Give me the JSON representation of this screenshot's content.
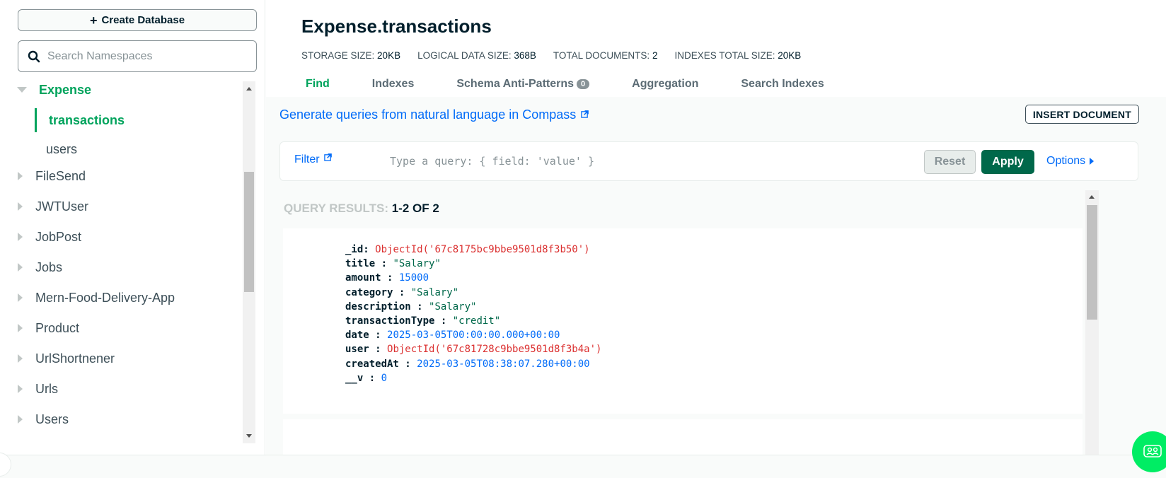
{
  "sidebar": {
    "create_database_label": "Create Database",
    "search_placeholder": "Search Namespaces",
    "databases": [
      {
        "name": "Expense",
        "expanded": true,
        "collections": [
          "transactions",
          "users"
        ],
        "active_collection": "transactions"
      },
      {
        "name": "FileSend"
      },
      {
        "name": "JWTUser"
      },
      {
        "name": "JobPost"
      },
      {
        "name": "Jobs"
      },
      {
        "name": "Mern-Food-Delivery-App"
      },
      {
        "name": "Product"
      },
      {
        "name": "UrlShortnener"
      },
      {
        "name": "Urls"
      },
      {
        "name": "Users"
      }
    ]
  },
  "header": {
    "title": "Expense.transactions",
    "stats": [
      {
        "label": "STORAGE SIZE:",
        "value": "20KB"
      },
      {
        "label": "LOGICAL DATA SIZE:",
        "value": "368B"
      },
      {
        "label": "TOTAL DOCUMENTS:",
        "value": "2"
      },
      {
        "label": "INDEXES TOTAL SIZE:",
        "value": "20KB"
      }
    ],
    "tabs": [
      {
        "label": "Find",
        "active": true
      },
      {
        "label": "Indexes"
      },
      {
        "label": "Schema Anti-Patterns",
        "badge": "0"
      },
      {
        "label": "Aggregation"
      },
      {
        "label": "Search Indexes"
      }
    ]
  },
  "toolbar": {
    "gen_queries_link": "Generate queries from natural language in Compass",
    "insert_document_label": "INSERT DOCUMENT"
  },
  "filter": {
    "label": "Filter",
    "placeholder": "Type a query: { field: 'value' }",
    "reset_label": "Reset",
    "apply_label": "Apply",
    "options_label": "Options"
  },
  "results": {
    "label": "QUERY RESULTS:",
    "count": "1-2 OF 2",
    "documents": [
      {
        "fields": [
          {
            "key": "_id",
            "value": "ObjectId('67c8175bc9bbe9501d8f3b50')",
            "type": "oid"
          },
          {
            "key": "title",
            "value": "\"Salary\"",
            "type": "str"
          },
          {
            "key": "amount",
            "value": "15000",
            "type": "num"
          },
          {
            "key": "category",
            "value": "\"Salary\"",
            "type": "str"
          },
          {
            "key": "description",
            "value": "\"Salary\"",
            "type": "str"
          },
          {
            "key": "transactionType",
            "value": "\"credit\"",
            "type": "str"
          },
          {
            "key": "date",
            "value": "2025-03-05T00:00:00.000+00:00",
            "type": "date"
          },
          {
            "key": "user",
            "value": "ObjectId('67c81728c9bbe9501d8f3b4a')",
            "type": "oid"
          },
          {
            "key": "createdAt",
            "value": "2025-03-05T08:38:07.280+00:00",
            "type": "date"
          },
          {
            "key": "__v",
            "value": "0",
            "type": "num"
          }
        ]
      }
    ]
  },
  "colors": {
    "accent_green": "#00a35c",
    "apply_green": "#00684a",
    "link_blue": "#016bf8",
    "oid_red": "#db3030"
  }
}
